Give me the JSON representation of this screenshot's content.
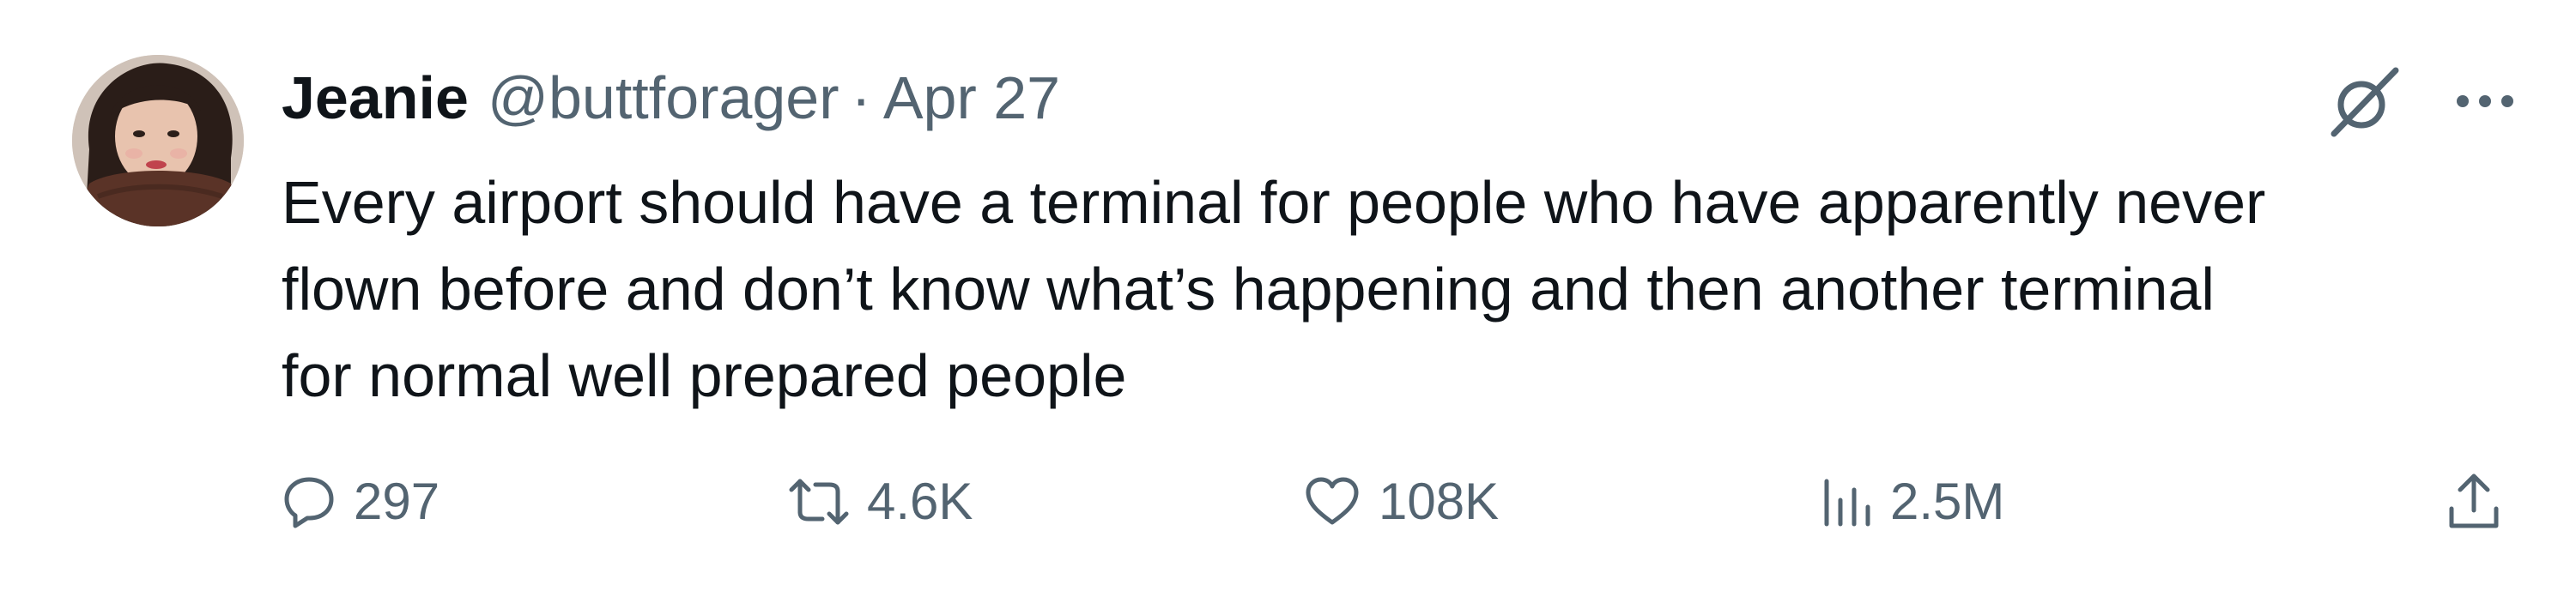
{
  "tweet": {
    "author": {
      "display_name": "Jeanie",
      "handle": "@buttforager"
    },
    "separator": "·",
    "date": "Apr 27",
    "text": "Every airport should have a terminal for people who have apparently never\nflown before and don’t know what’s happening and then another terminal\nfor normal well prepared people",
    "stats": {
      "replies": "297",
      "retweets": "4.6K",
      "likes": "108K",
      "views": "2.5M"
    }
  },
  "icons": {
    "avatar": "avatar-photo",
    "grok": "grok-icon",
    "more": "more-icon",
    "reply": "reply-icon",
    "retweet": "retweet-icon",
    "like": "heart-icon",
    "views": "views-icon",
    "share": "share-icon"
  },
  "colors": {
    "text_primary": "#0f1419",
    "text_secondary": "#536471",
    "background": "#ffffff"
  }
}
